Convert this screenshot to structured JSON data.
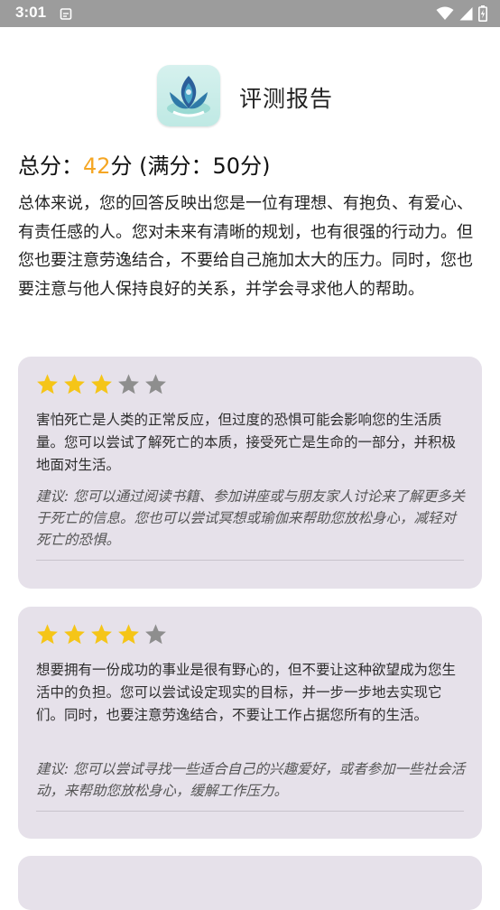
{
  "status_bar": {
    "time": "3:01",
    "icons": [
      "notification-icon",
      "wifi-icon",
      "signal-icon",
      "battery-icon"
    ]
  },
  "header": {
    "title": "评测报告",
    "logo": "lotus-logo-icon"
  },
  "score": {
    "label": "总分：",
    "value": "42",
    "unit_suffix": "分 (满分：50分)"
  },
  "summary": "总体来说，您的回答反映出您是一位有理想、有抱负、有爱心、有责任感的人。您对未来有清晰的规划，也有很强的行动力。但您也要注意劳逸结合，不要给自己施加太大的压力。同时，您也要注意与他人保持良好的关系，并学会寻求他人的帮助。",
  "colors": {
    "accent": "#f5a623",
    "star_filled": "#f5c518",
    "star_empty": "#8e8e8e",
    "card_bg": "#e6e1ea",
    "status_bar": "#9c9c9c"
  },
  "cards": [
    {
      "rating": 3,
      "max_rating": 5,
      "text": "害怕死亡是人类的正常反应，但过度的恐惧可能会影响您的生活质量。您可以尝试了解死亡的本质，接受死亡是生命的一部分，并积极地面对生活。",
      "suggestion": "建议: 您可以通过阅读书籍、参加讲座或与朋友家人讨论来了解更多关于死亡的信息。您也可以尝试冥想或瑜伽来帮助您放松身心，减轻对死亡的恐惧。"
    },
    {
      "rating": 4,
      "max_rating": 5,
      "text": "想要拥有一份成功的事业是很有野心的，但不要让这种欲望成为您生活中的负担。您可以尝试设定现实的目标，并一步一步地去实现它们。同时，也要注意劳逸结合，不要让工作占据您所有的生活。",
      "suggestion": "建议: 您可以尝试寻找一些适合自己的兴趣爱好，或者参加一些社会活动，来帮助您放松身心，缓解工作压力。"
    }
  ]
}
